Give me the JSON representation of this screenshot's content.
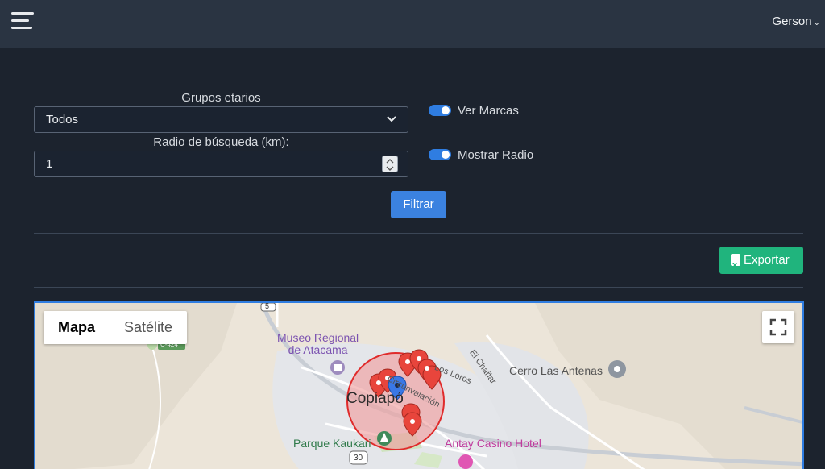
{
  "header": {
    "user_name": "Gerson",
    "user_caret": "⌄"
  },
  "filters": {
    "age_group_label": "Grupos etarios",
    "age_group_value": "Todos",
    "radius_label": "Radio de búsqueda (km):",
    "radius_value": "1",
    "show_marks_label": "Ver Marcas",
    "show_marks_on": true,
    "show_radius_label": "Mostrar Radio",
    "show_radius_on": true,
    "filter_button": "Filtrar"
  },
  "actions": {
    "export_button": "Exportar"
  },
  "map": {
    "type_map": "Mapa",
    "type_satellite": "Satélite",
    "labels": {
      "museum": "Museo Regional\nde Atacama",
      "cerro": "Cerro Las Antenas",
      "copiapo": "Copiapó",
      "park": "Parque Kaukari",
      "casino": "Antay Casino Hotel",
      "circunvalacion": "Circunvalación",
      "los_loros": "Los Loros",
      "el_chanar": "El Chañar",
      "route5": "5",
      "route30": "30",
      "c424": "C-424"
    }
  },
  "colors": {
    "accent": "#3b82e0",
    "export": "#20b47d",
    "radius_fill": "#f0a0a0",
    "radius_stroke": "#e02b2b",
    "marker": "#e8453c"
  }
}
